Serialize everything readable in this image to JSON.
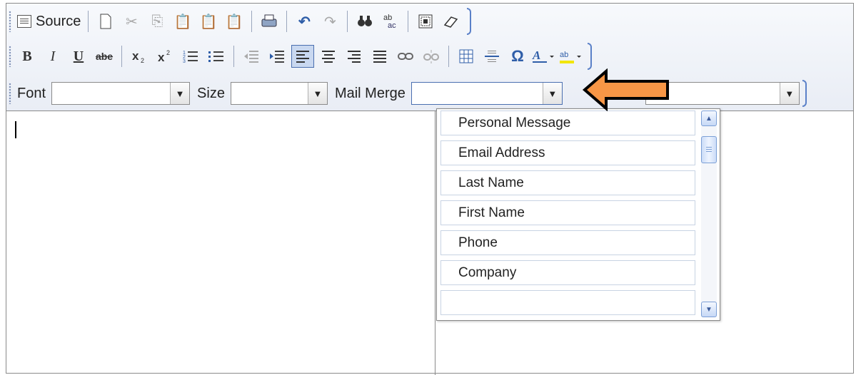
{
  "toolbar": {
    "row1": {
      "source_label": "Source",
      "icons": [
        "new-page-icon",
        "cut-icon",
        "copy-icon",
        "paste-icon",
        "paste-text-icon",
        "paste-word-icon",
        "print-icon",
        "undo-icon",
        "redo-icon",
        "find-icon",
        "replace-icon",
        "select-all-icon",
        "remove-format-icon"
      ]
    },
    "row2": {
      "icons": [
        "bold-icon",
        "italic-icon",
        "underline-icon",
        "strikethrough-icon",
        "subscript-icon",
        "superscript-icon",
        "numbered-list-icon",
        "bulleted-list-icon",
        "outdent-icon",
        "indent-icon",
        "align-left-icon",
        "align-center-icon",
        "align-right-icon",
        "justify-icon",
        "link-icon",
        "unlink-icon",
        "table-icon",
        "horizontal-rule-icon",
        "special-char-icon",
        "text-color-icon",
        "bg-color-icon"
      ],
      "bold_glyph": "B",
      "italic_glyph": "I",
      "underline_glyph": "U",
      "strike_glyph": "abe",
      "omega_glyph": "Ω"
    },
    "row3": {
      "font_label": "Font",
      "font_value": "",
      "size_label": "Size",
      "size_value": "",
      "mailmerge_label": "Mail Merge",
      "mailmerge_value": "",
      "extra_value": ""
    }
  },
  "editor": {
    "content": ""
  },
  "mailmerge_dropdown": {
    "items": [
      "Personal Message",
      "Email Address",
      "Last Name",
      "First Name",
      "Phone",
      "Company",
      ""
    ]
  },
  "colors": {
    "accent": "#4a6fb0",
    "arrow_fill": "#f79646",
    "arrow_stroke": "#000000"
  }
}
